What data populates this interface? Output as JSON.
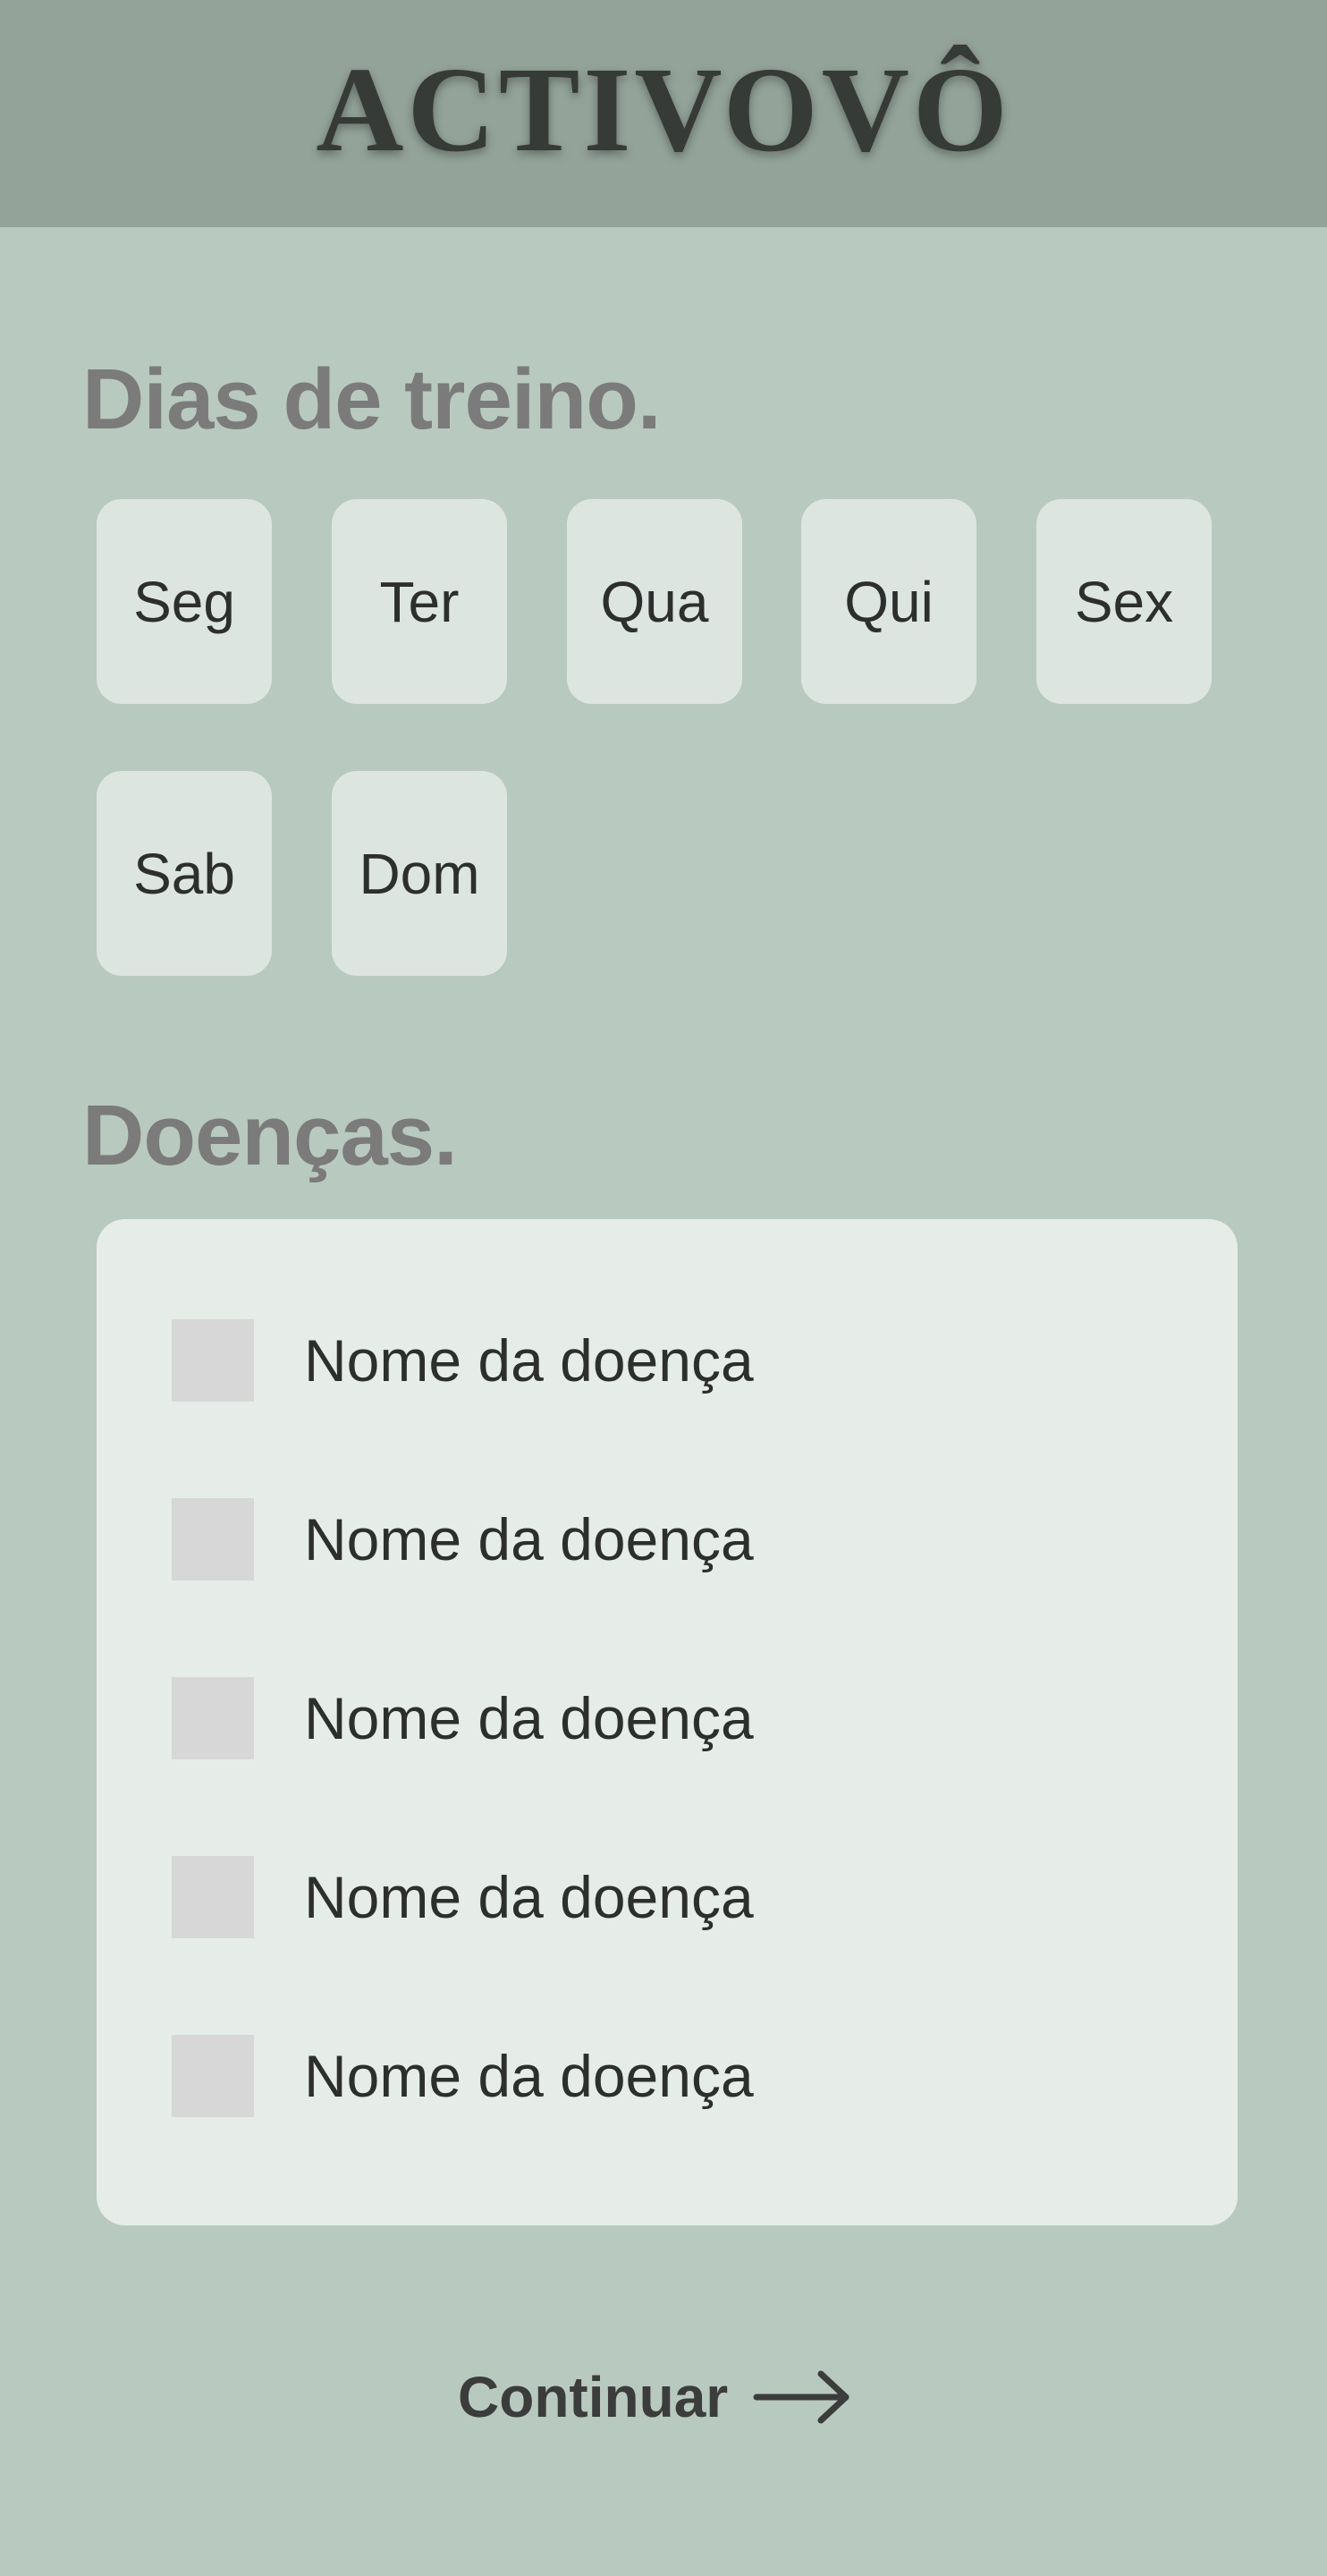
{
  "app": {
    "title": "ACTIVOVÔ"
  },
  "training_days": {
    "title": "Dias de treino.",
    "days": [
      {
        "label": "Seg"
      },
      {
        "label": "Ter"
      },
      {
        "label": "Qua"
      },
      {
        "label": "Qui"
      },
      {
        "label": "Sex"
      },
      {
        "label": "Sab"
      },
      {
        "label": "Dom"
      }
    ]
  },
  "diseases": {
    "title": "Doenças.",
    "items": [
      {
        "label": "Nome da doença",
        "checked": false
      },
      {
        "label": "Nome da doença",
        "checked": false
      },
      {
        "label": "Nome da doença",
        "checked": false
      },
      {
        "label": "Nome da doença",
        "checked": false
      },
      {
        "label": "Nome da doença",
        "checked": false
      }
    ]
  },
  "footer": {
    "continue_label": "Continuar",
    "continue_icon": "arrow-right-icon"
  },
  "colors": {
    "background": "#b8c9bf",
    "header": "#93a39a",
    "title_text": "#363b38",
    "section_title": "#7a7b7a",
    "day_button": "#dde5e0",
    "card": "#e6ece8",
    "checkbox": "#d7d7d7"
  }
}
